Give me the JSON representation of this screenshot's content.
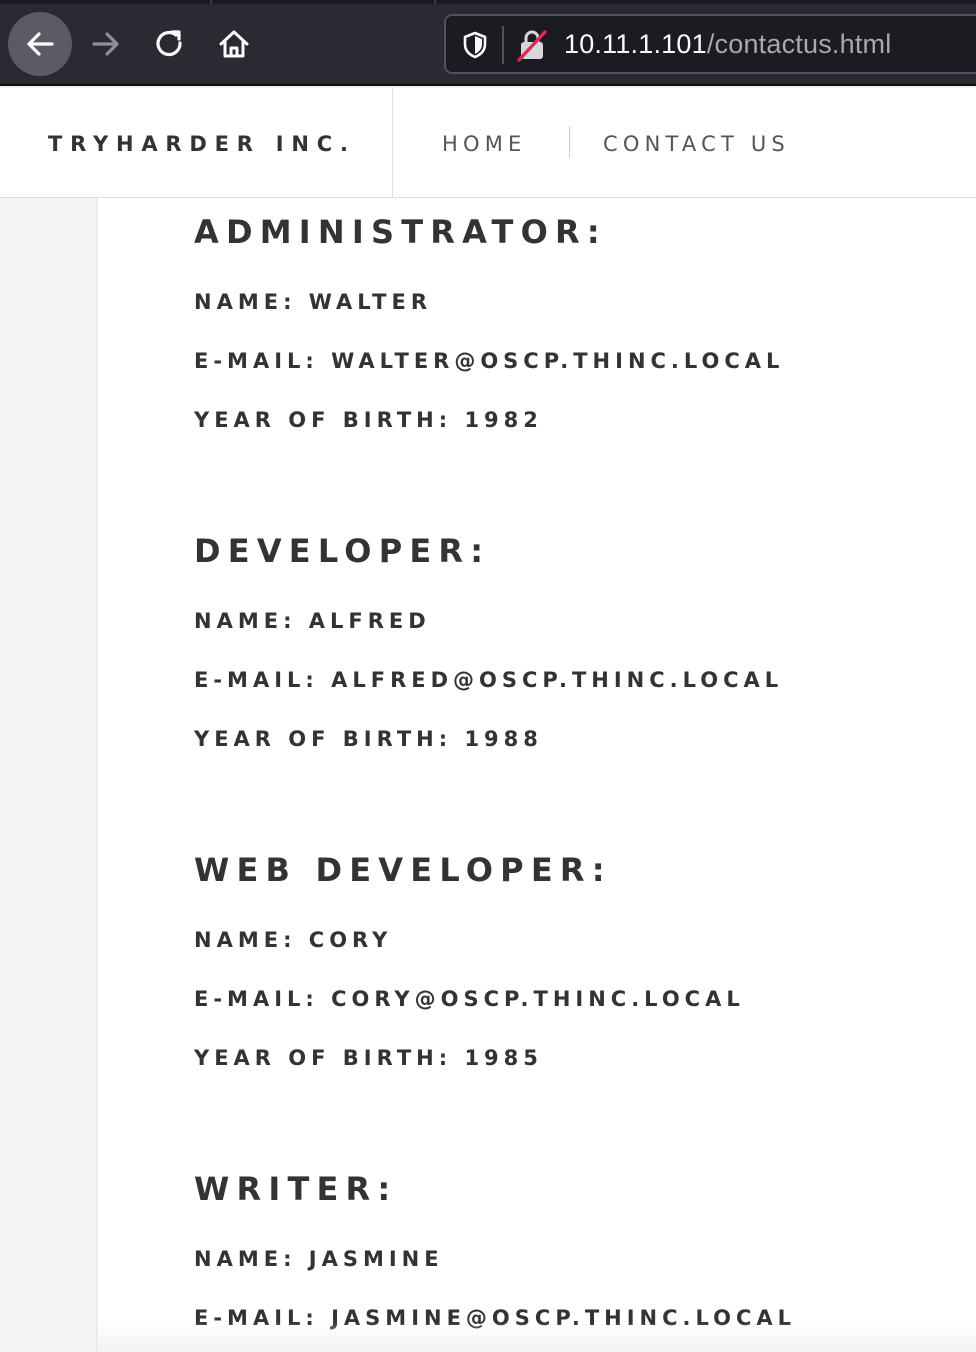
{
  "browser": {
    "url_host": "10.11.1.101",
    "url_path": "/contactus.html"
  },
  "site": {
    "brand": "TRYHARDER INC.",
    "nav": [
      "HOME",
      "CONTACT US"
    ]
  },
  "contacts": [
    {
      "role": "ADMINISTRATOR:",
      "name": "NAME: WALTER",
      "email": "E-MAIL: WALTER@OSCP.THINC.LOCAL",
      "year": "YEAR OF BIRTH: 1982"
    },
    {
      "role": "DEVELOPER:",
      "name": "NAME: ALFRED",
      "email": "E-MAIL: ALFRED@OSCP.THINC.LOCAL",
      "year": "YEAR OF BIRTH: 1988"
    },
    {
      "role": "WEB DEVELOPER:",
      "name": "NAME: CORY",
      "email": "E-MAIL: CORY@OSCP.THINC.LOCAL",
      "year": "YEAR OF BIRTH: 1985"
    },
    {
      "role": "WRITER:",
      "name": "NAME: JASMINE",
      "email": "E-MAIL: JASMINE@OSCP.THINC.LOCAL",
      "year": ""
    }
  ]
}
